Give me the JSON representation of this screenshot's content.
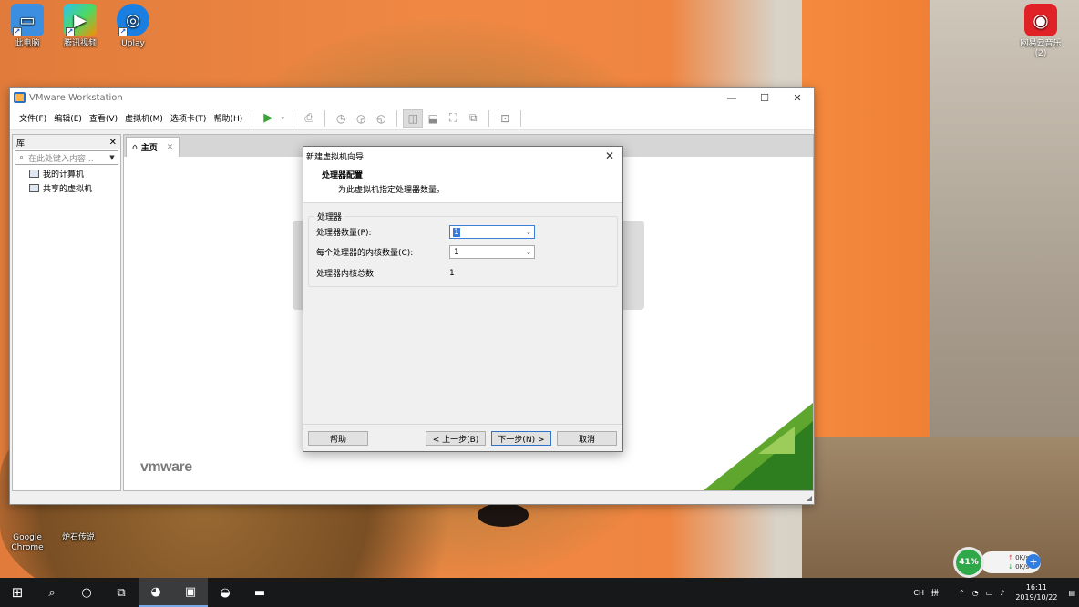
{
  "desktop": {
    "icons": [
      {
        "label": "此电脑"
      },
      {
        "label": "腾讯视频"
      },
      {
        "label": "Uplay"
      },
      {
        "label": "Google Chrome"
      },
      {
        "label": "炉石传说"
      },
      {
        "label": "网易云音乐 (2)"
      }
    ]
  },
  "vmware": {
    "title": "VMware Workstation",
    "menu": [
      "文件(F)",
      "编辑(E)",
      "查看(V)",
      "虚拟机(M)",
      "选项卡(T)",
      "帮助(H)"
    ],
    "library": {
      "title": "库",
      "search_placeholder": "在此处键入内容...",
      "tree": [
        "我的计算机",
        "共享的虚拟机"
      ]
    },
    "tab": {
      "label": "主页"
    },
    "logo": "vmware"
  },
  "wizard": {
    "title": "新建虚拟机向导",
    "heading": "处理器配置",
    "subheading": "为此虚拟机指定处理器数量。",
    "group_title": "处理器",
    "fields": {
      "processor_count_label": "处理器数量(P):",
      "processor_count_value": "1",
      "cores_per_processor_label": "每个处理器的内核数量(C):",
      "cores_per_processor_value": "1",
      "total_cores_label": "处理器内核总数:",
      "total_cores_value": "1"
    },
    "buttons": {
      "help": "帮助",
      "back": "< 上一步(B)",
      "next": "下一步(N) >",
      "cancel": "取消"
    }
  },
  "widgets": {
    "speed_percent": "41%",
    "upload": "0K/s",
    "download": "0K/s"
  },
  "taskbar": {
    "lang": "CH",
    "ime": "拼",
    "time": "16:11",
    "date": "2019/10/22"
  }
}
